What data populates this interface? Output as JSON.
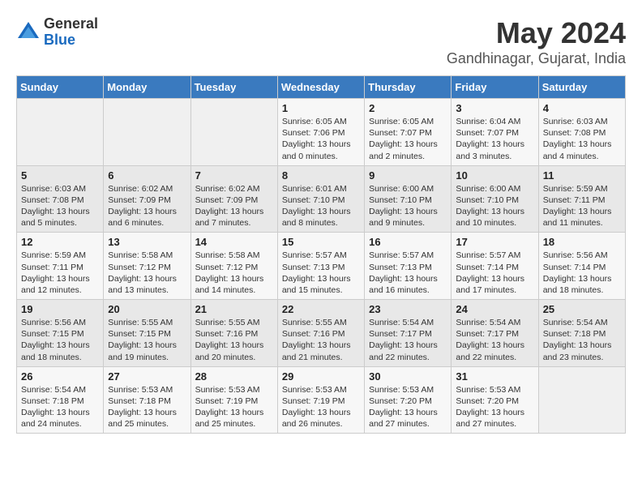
{
  "logo": {
    "general": "General",
    "blue": "Blue"
  },
  "calendar": {
    "title": "May 2024",
    "subtitle": "Gandhinagar, Gujarat, India"
  },
  "weekdays": [
    "Sunday",
    "Monday",
    "Tuesday",
    "Wednesday",
    "Thursday",
    "Friday",
    "Saturday"
  ],
  "weeks": [
    [
      {
        "day": "",
        "info": ""
      },
      {
        "day": "",
        "info": ""
      },
      {
        "day": "",
        "info": ""
      },
      {
        "day": "1",
        "info": "Sunrise: 6:05 AM\nSunset: 7:06 PM\nDaylight: 13 hours\nand 0 minutes."
      },
      {
        "day": "2",
        "info": "Sunrise: 6:05 AM\nSunset: 7:07 PM\nDaylight: 13 hours\nand 2 minutes."
      },
      {
        "day": "3",
        "info": "Sunrise: 6:04 AM\nSunset: 7:07 PM\nDaylight: 13 hours\nand 3 minutes."
      },
      {
        "day": "4",
        "info": "Sunrise: 6:03 AM\nSunset: 7:08 PM\nDaylight: 13 hours\nand 4 minutes."
      }
    ],
    [
      {
        "day": "5",
        "info": "Sunrise: 6:03 AM\nSunset: 7:08 PM\nDaylight: 13 hours\nand 5 minutes."
      },
      {
        "day": "6",
        "info": "Sunrise: 6:02 AM\nSunset: 7:09 PM\nDaylight: 13 hours\nand 6 minutes."
      },
      {
        "day": "7",
        "info": "Sunrise: 6:02 AM\nSunset: 7:09 PM\nDaylight: 13 hours\nand 7 minutes."
      },
      {
        "day": "8",
        "info": "Sunrise: 6:01 AM\nSunset: 7:10 PM\nDaylight: 13 hours\nand 8 minutes."
      },
      {
        "day": "9",
        "info": "Sunrise: 6:00 AM\nSunset: 7:10 PM\nDaylight: 13 hours\nand 9 minutes."
      },
      {
        "day": "10",
        "info": "Sunrise: 6:00 AM\nSunset: 7:10 PM\nDaylight: 13 hours\nand 10 minutes."
      },
      {
        "day": "11",
        "info": "Sunrise: 5:59 AM\nSunset: 7:11 PM\nDaylight: 13 hours\nand 11 minutes."
      }
    ],
    [
      {
        "day": "12",
        "info": "Sunrise: 5:59 AM\nSunset: 7:11 PM\nDaylight: 13 hours\nand 12 minutes."
      },
      {
        "day": "13",
        "info": "Sunrise: 5:58 AM\nSunset: 7:12 PM\nDaylight: 13 hours\nand 13 minutes."
      },
      {
        "day": "14",
        "info": "Sunrise: 5:58 AM\nSunset: 7:12 PM\nDaylight: 13 hours\nand 14 minutes."
      },
      {
        "day": "15",
        "info": "Sunrise: 5:57 AM\nSunset: 7:13 PM\nDaylight: 13 hours\nand 15 minutes."
      },
      {
        "day": "16",
        "info": "Sunrise: 5:57 AM\nSunset: 7:13 PM\nDaylight: 13 hours\nand 16 minutes."
      },
      {
        "day": "17",
        "info": "Sunrise: 5:57 AM\nSunset: 7:14 PM\nDaylight: 13 hours\nand 17 minutes."
      },
      {
        "day": "18",
        "info": "Sunrise: 5:56 AM\nSunset: 7:14 PM\nDaylight: 13 hours\nand 18 minutes."
      }
    ],
    [
      {
        "day": "19",
        "info": "Sunrise: 5:56 AM\nSunset: 7:15 PM\nDaylight: 13 hours\nand 18 minutes."
      },
      {
        "day": "20",
        "info": "Sunrise: 5:55 AM\nSunset: 7:15 PM\nDaylight: 13 hours\nand 19 minutes."
      },
      {
        "day": "21",
        "info": "Sunrise: 5:55 AM\nSunset: 7:16 PM\nDaylight: 13 hours\nand 20 minutes."
      },
      {
        "day": "22",
        "info": "Sunrise: 5:55 AM\nSunset: 7:16 PM\nDaylight: 13 hours\nand 21 minutes."
      },
      {
        "day": "23",
        "info": "Sunrise: 5:54 AM\nSunset: 7:17 PM\nDaylight: 13 hours\nand 22 minutes."
      },
      {
        "day": "24",
        "info": "Sunrise: 5:54 AM\nSunset: 7:17 PM\nDaylight: 13 hours\nand 22 minutes."
      },
      {
        "day": "25",
        "info": "Sunrise: 5:54 AM\nSunset: 7:18 PM\nDaylight: 13 hours\nand 23 minutes."
      }
    ],
    [
      {
        "day": "26",
        "info": "Sunrise: 5:54 AM\nSunset: 7:18 PM\nDaylight: 13 hours\nand 24 minutes."
      },
      {
        "day": "27",
        "info": "Sunrise: 5:53 AM\nSunset: 7:18 PM\nDaylight: 13 hours\nand 25 minutes."
      },
      {
        "day": "28",
        "info": "Sunrise: 5:53 AM\nSunset: 7:19 PM\nDaylight: 13 hours\nand 25 minutes."
      },
      {
        "day": "29",
        "info": "Sunrise: 5:53 AM\nSunset: 7:19 PM\nDaylight: 13 hours\nand 26 minutes."
      },
      {
        "day": "30",
        "info": "Sunrise: 5:53 AM\nSunset: 7:20 PM\nDaylight: 13 hours\nand 27 minutes."
      },
      {
        "day": "31",
        "info": "Sunrise: 5:53 AM\nSunset: 7:20 PM\nDaylight: 13 hours\nand 27 minutes."
      },
      {
        "day": "",
        "info": ""
      }
    ]
  ]
}
